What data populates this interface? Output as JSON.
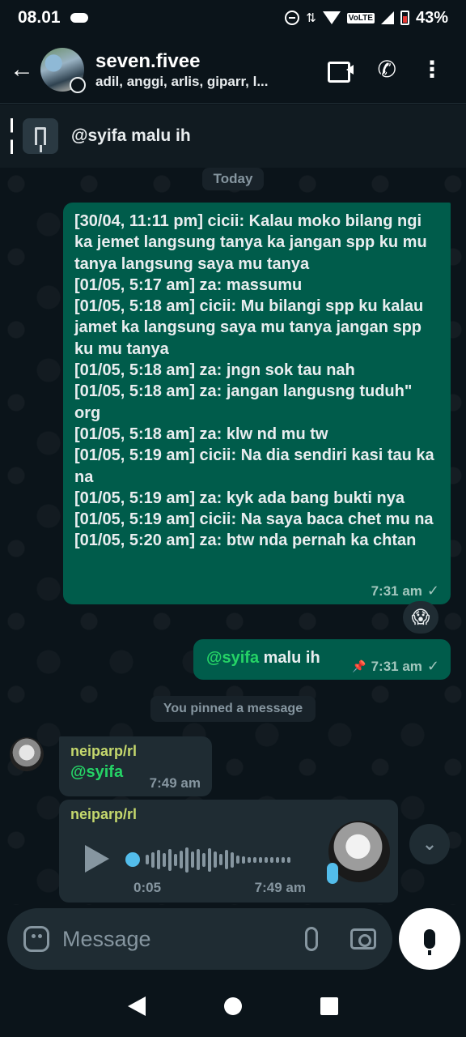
{
  "status_bar": {
    "time": "08.01",
    "volte": "VoLTE",
    "battery": "43%"
  },
  "header": {
    "title": "seven.fivee",
    "members": "adil, anggi, arlis, giparr, l..."
  },
  "pinned": {
    "text": "@syifa malu ih"
  },
  "chat": {
    "date_chip": "Today",
    "long_message": {
      "text": "[30/04, 11:11 pm] cicii: Kalau moko bilang ngi ka jemet langsung tanya ka jangan spp ku mu tanya langsung saya mu tanya\n[01/05, 5:17 am] za: massumu\n[01/05, 5:18 am] cicii: Mu bilangi spp ku kalau jamet ka langsung saya mu tanya jangan spp ku mu tanya\n[01/05, 5:18 am] za: jngn sok tau nah\n[01/05, 5:18 am] za: jangan langusng tuduh\" org\n[01/05, 5:18 am] za: klw nd mu tw\n[01/05, 5:19 am] cicii: Na dia sendiri kasi tau ka na\n[01/05, 5:19 am] za: kyk ada bang bukti nya\n[01/05, 5:19 am] cicii: Na saya baca chet mu na\n[01/05, 5:20 am] za: btw nda pernah ka chtan",
      "time": "7:31 am",
      "tick": "✓"
    },
    "reaction": "😱",
    "short_message": {
      "mention": "@syifa",
      "body": " malu ih",
      "time": "7:31 am",
      "tick": "✓"
    },
    "system_chip": "You pinned a message",
    "incoming_1": {
      "sender": "neiparp/rl",
      "mention": "@syifa",
      "time": "7:49 am"
    },
    "incoming_2": {
      "sender": "neiparp/rl",
      "duration": "0:05",
      "time": "7:49 am"
    }
  },
  "composer": {
    "placeholder": "Message"
  },
  "waveform_levels": [
    0.35,
    0.55,
    0.7,
    0.5,
    0.8,
    0.45,
    0.65,
    0.9,
    0.6,
    0.75,
    0.5,
    0.85,
    0.6,
    0.4,
    0.7,
    0.55,
    0.3,
    0.25,
    0.2,
    0.2,
    0.2,
    0.2,
    0.2,
    0.2,
    0.2,
    0.2
  ]
}
